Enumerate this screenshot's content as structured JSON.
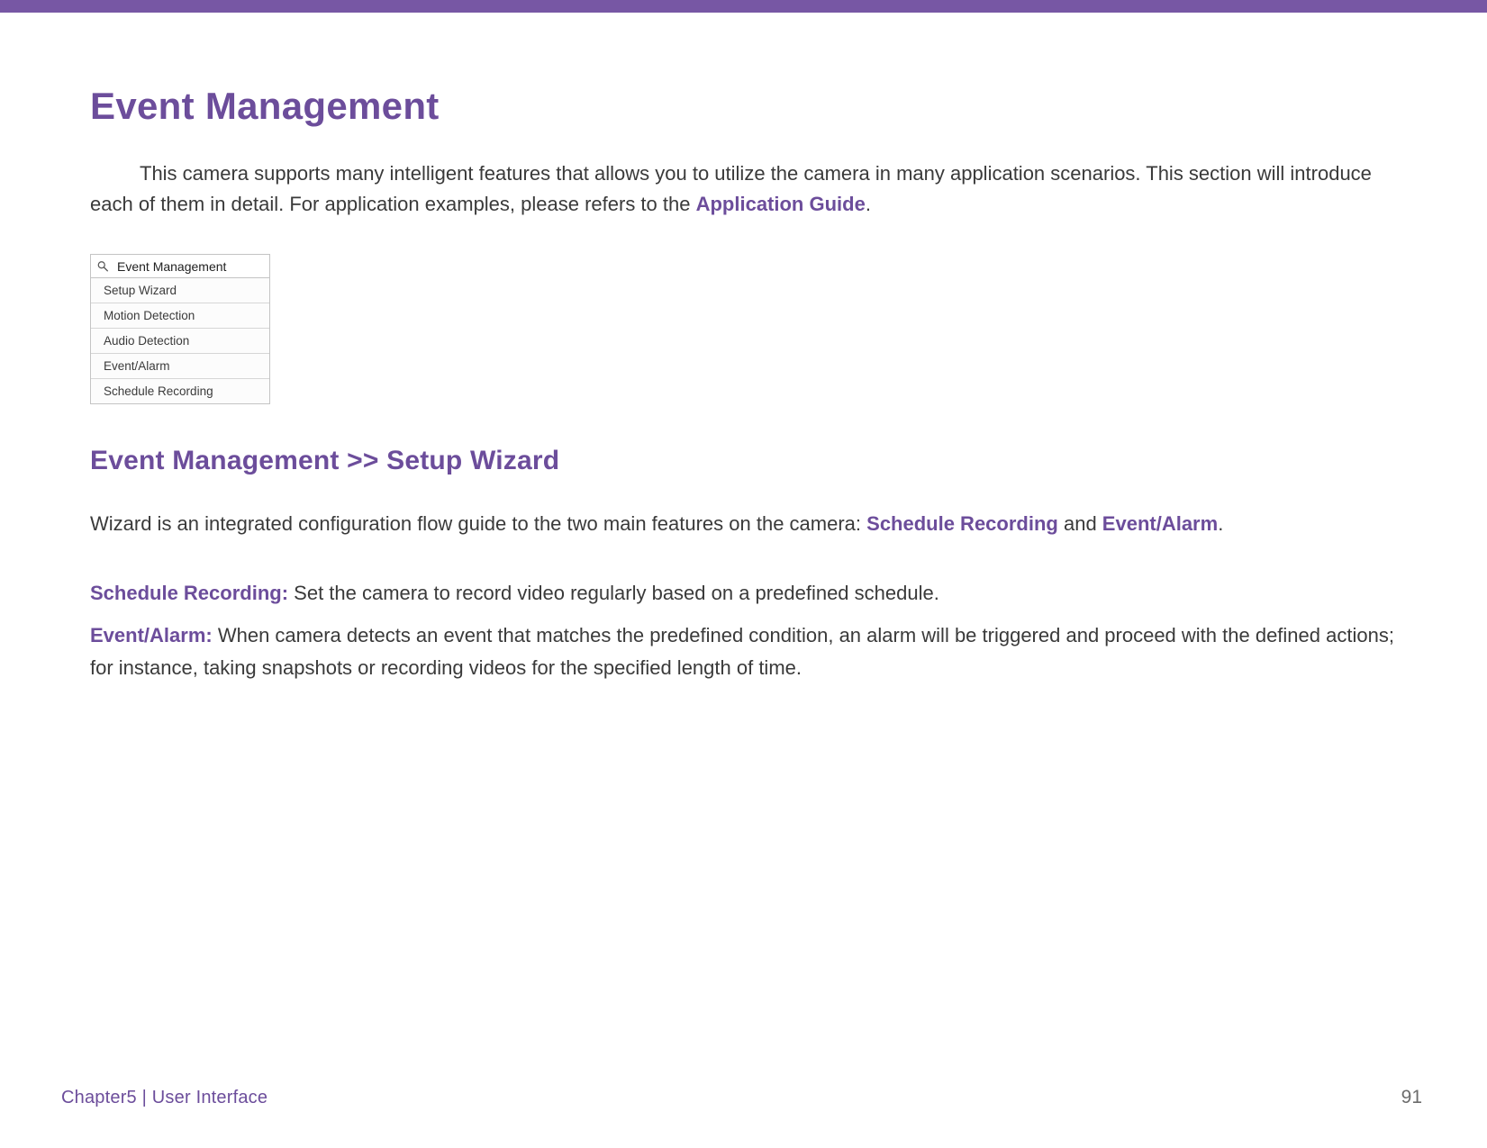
{
  "title": "Event Management",
  "intro": {
    "text_a": "This camera supports many intelligent features that allows you to utilize the camera in many application scenarios. This section will introduce each of them in detail. For application examples, please refers to the ",
    "link": "Application Guide",
    "text_b": "."
  },
  "panel": {
    "header": "Event Management",
    "items": [
      "Setup Wizard",
      "Motion Detection",
      "Audio Detection",
      "Event/Alarm",
      "Schedule Recording"
    ]
  },
  "section_title": "Event Management >> Setup Wizard",
  "wizard_sentence": {
    "a": "Wizard is an integrated configuration flow guide to the two main features on the camera:  ",
    "link1": "Schedule Recording",
    "b": " and ",
    "link2": "Event/Alarm",
    "c": "."
  },
  "definitions": [
    {
      "term": "Schedule Recording:",
      "text": " Set the camera to record video regularly based on a predefined schedule."
    },
    {
      "term": "Event/Alarm:",
      "text": " When camera detects an event that matches the predefined condition, an alarm will be triggered and proceed with the defined actions; for instance, taking snapshots or recording videos for the specified length of time."
    }
  ],
  "footer": {
    "chapter": "Chapter5  |  User Interface",
    "page": "91"
  }
}
